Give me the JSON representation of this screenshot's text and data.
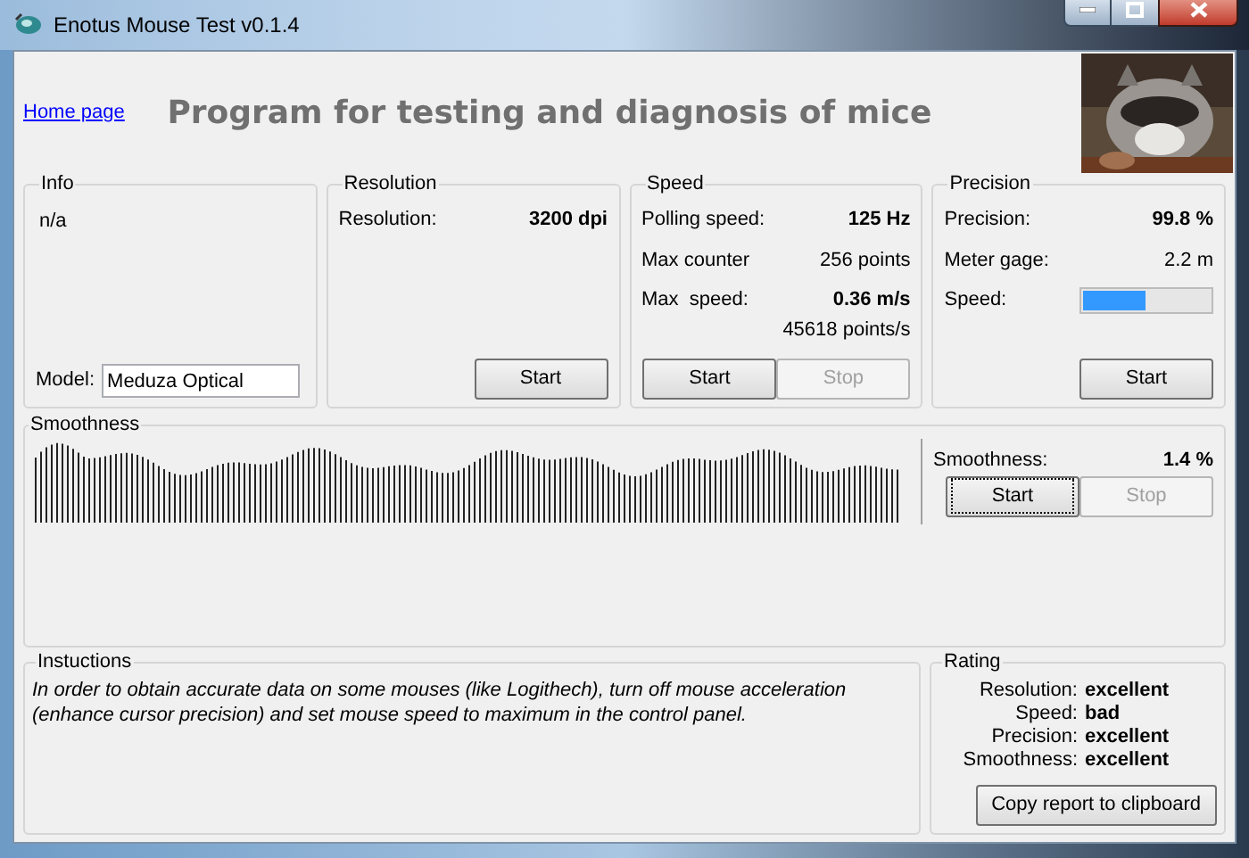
{
  "window": {
    "title": "Enotus Mouse Test v0.1.4"
  },
  "header": {
    "link": "Home page",
    "title": "Program for testing and diagnosis of mice"
  },
  "info": {
    "title": "Info",
    "value": "n/a",
    "model_label": "Model:",
    "model_value": "Meduza Optical"
  },
  "resolution": {
    "title": "Resolution",
    "rows": [
      {
        "kind": "pair",
        "label": "Resolution:",
        "value": "3200 dpi",
        "bold": true
      }
    ],
    "buttons": [
      {
        "label": "Start",
        "disabled": false
      }
    ]
  },
  "speed": {
    "title": "Speed",
    "rows": [
      {
        "kind": "pair",
        "label": "Polling speed:",
        "value": "125 Hz",
        "bold": true
      },
      {
        "kind": "pair",
        "label": "Max counter",
        "value": "256 points",
        "bold": false
      },
      {
        "kind": "pair",
        "label": "Max  speed:",
        "value": "0.36 m/s",
        "bold": true
      },
      {
        "kind": "sub",
        "value": "45618 points/s"
      }
    ],
    "buttons": [
      {
        "label": "Start",
        "disabled": false
      },
      {
        "label": "Stop",
        "disabled": true
      }
    ]
  },
  "precision": {
    "title": "Precision",
    "rows": [
      {
        "kind": "pair",
        "label": "Precision:",
        "value": "99.8 %",
        "bold": true
      },
      {
        "kind": "pair",
        "label": "Meter gage:",
        "value": "2.2 m",
        "bold": false
      },
      {
        "kind": "meter",
        "label": "Speed:",
        "level": 0.5
      }
    ],
    "buttons": [
      {
        "label": "Start",
        "disabled": false
      }
    ]
  },
  "smoothness": {
    "title": "Smoothness",
    "label": "Smoothness:",
    "value": "1.4 %",
    "buttons": [
      {
        "label": "Start",
        "disabled": false,
        "focused": true
      },
      {
        "label": "Stop",
        "disabled": true,
        "focused": false
      }
    ]
  },
  "instructions": {
    "title": "Instuctions",
    "text": "In order to obtain accurate data on some mouses (like Logithech), turn off mouse acceleration (enhance cursor precision) and set mouse speed to maximum in the control panel."
  },
  "rating": {
    "title": "Rating",
    "rows": [
      {
        "label": "Resolution:",
        "value": "excellent"
      },
      {
        "label": "Speed:",
        "value": "bad"
      },
      {
        "label": "Precision:",
        "value": "excellent"
      },
      {
        "label": "Smoothness:",
        "value": "excellent"
      }
    ],
    "button": "Copy report to clipboard"
  }
}
